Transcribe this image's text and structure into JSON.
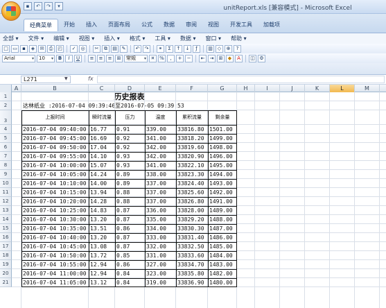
{
  "window": {
    "title": "unitReport.xls  [兼容模式] - Microsoft Excel"
  },
  "ribbon": {
    "tabs": [
      "经典菜单",
      "开始",
      "插入",
      "页面布局",
      "公式",
      "数据",
      "审阅",
      "视图",
      "开发工具",
      "加载项"
    ],
    "active_tab": "经典菜单"
  },
  "menu": {
    "items": [
      "全部 ▾",
      "文件 ▾",
      "编辑 ▾",
      "视图 ▾",
      "插入 ▾",
      "格式 ▾",
      "工具 ▾",
      "数据 ▾",
      "窗口 ▾",
      "帮助 ▾"
    ]
  },
  "toolbar": {
    "font_name": "Arial",
    "font_size": "10",
    "number_format": "常规"
  },
  "formula_bar": {
    "name_box": "L271",
    "fx": "fx",
    "content": ""
  },
  "columns": [
    "A",
    "B",
    "C",
    "D",
    "E",
    "F",
    "G",
    "H",
    "I",
    "J",
    "K",
    "L",
    "M"
  ],
  "selected_column": "L",
  "rows": [
    "1",
    "2",
    "3",
    "4",
    "5",
    "6",
    "7",
    "8",
    "9",
    "10",
    "11",
    "12",
    "13",
    "14",
    "15",
    "16",
    "17",
    "18",
    "19",
    "20",
    "21"
  ],
  "report": {
    "title": "历史报表",
    "subtitle": "达林纸业 :2016-07-04 09:39:46至2016-07-05 09:39:53",
    "headers": [
      "上报时间",
      "瞬时流量",
      "压力",
      "温度",
      "累积流量",
      "剩余量"
    ],
    "rows": [
      [
        "2016-07-04 09:40:00",
        "16.77",
        "0.91",
        "339.00",
        "33816.80",
        "1501.00"
      ],
      [
        "2016-07-04 09:45:00",
        "16.69",
        "0.92",
        "341.00",
        "33818.20",
        "1499.00"
      ],
      [
        "2016-07-04 09:50:00",
        "17.04",
        "0.92",
        "342.00",
        "33819.60",
        "1498.00"
      ],
      [
        "2016-07-04 09:55:00",
        "14.10",
        "0.93",
        "342.00",
        "33820.90",
        "1496.00"
      ],
      [
        "2016-07-04 10:00:00",
        "15.07",
        "0.93",
        "341.00",
        "33822.10",
        "1495.00"
      ],
      [
        "2016-07-04 10:05:00",
        "14.24",
        "0.89",
        "338.00",
        "33823.30",
        "1494.00"
      ],
      [
        "2016-07-04 10:10:00",
        "14.00",
        "0.89",
        "337.00",
        "33824.40",
        "1493.00"
      ],
      [
        "2016-07-04 10:15:00",
        "13.94",
        "0.88",
        "337.00",
        "33825.60",
        "1492.00"
      ],
      [
        "2016-07-04 10:20:00",
        "14.28",
        "0.88",
        "337.00",
        "33826.80",
        "1491.00"
      ],
      [
        "2016-07-04 10:25:00",
        "14.83",
        "0.87",
        "336.00",
        "33828.00",
        "1489.00"
      ],
      [
        "2016-07-04 10:30:00",
        "13.20",
        "0.87",
        "335.00",
        "33829.20",
        "1488.00"
      ],
      [
        "2016-07-04 10:35:00",
        "13.51",
        "0.86",
        "334.00",
        "33830.30",
        "1487.00"
      ],
      [
        "2016-07-04 10:40:00",
        "13.20",
        "0.87",
        "333.00",
        "33831.40",
        "1486.00"
      ],
      [
        "2016-07-04 10:45:00",
        "13.08",
        "0.87",
        "332.00",
        "33832.50",
        "1485.00"
      ],
      [
        "2016-07-04 10:50:00",
        "13.72",
        "0.85",
        "331.00",
        "33833.60",
        "1484.00"
      ],
      [
        "2016-07-04 10:55:00",
        "12.94",
        "0.86",
        "327.00",
        "33834.70",
        "1483.00"
      ],
      [
        "2016-07-04 11:00:00",
        "12.94",
        "0.84",
        "323.00",
        "33835.80",
        "1482.00"
      ],
      [
        "2016-07-04 11:05:00",
        "13.12",
        "0.84",
        "319.00",
        "33836.90",
        "1480.00"
      ]
    ]
  }
}
